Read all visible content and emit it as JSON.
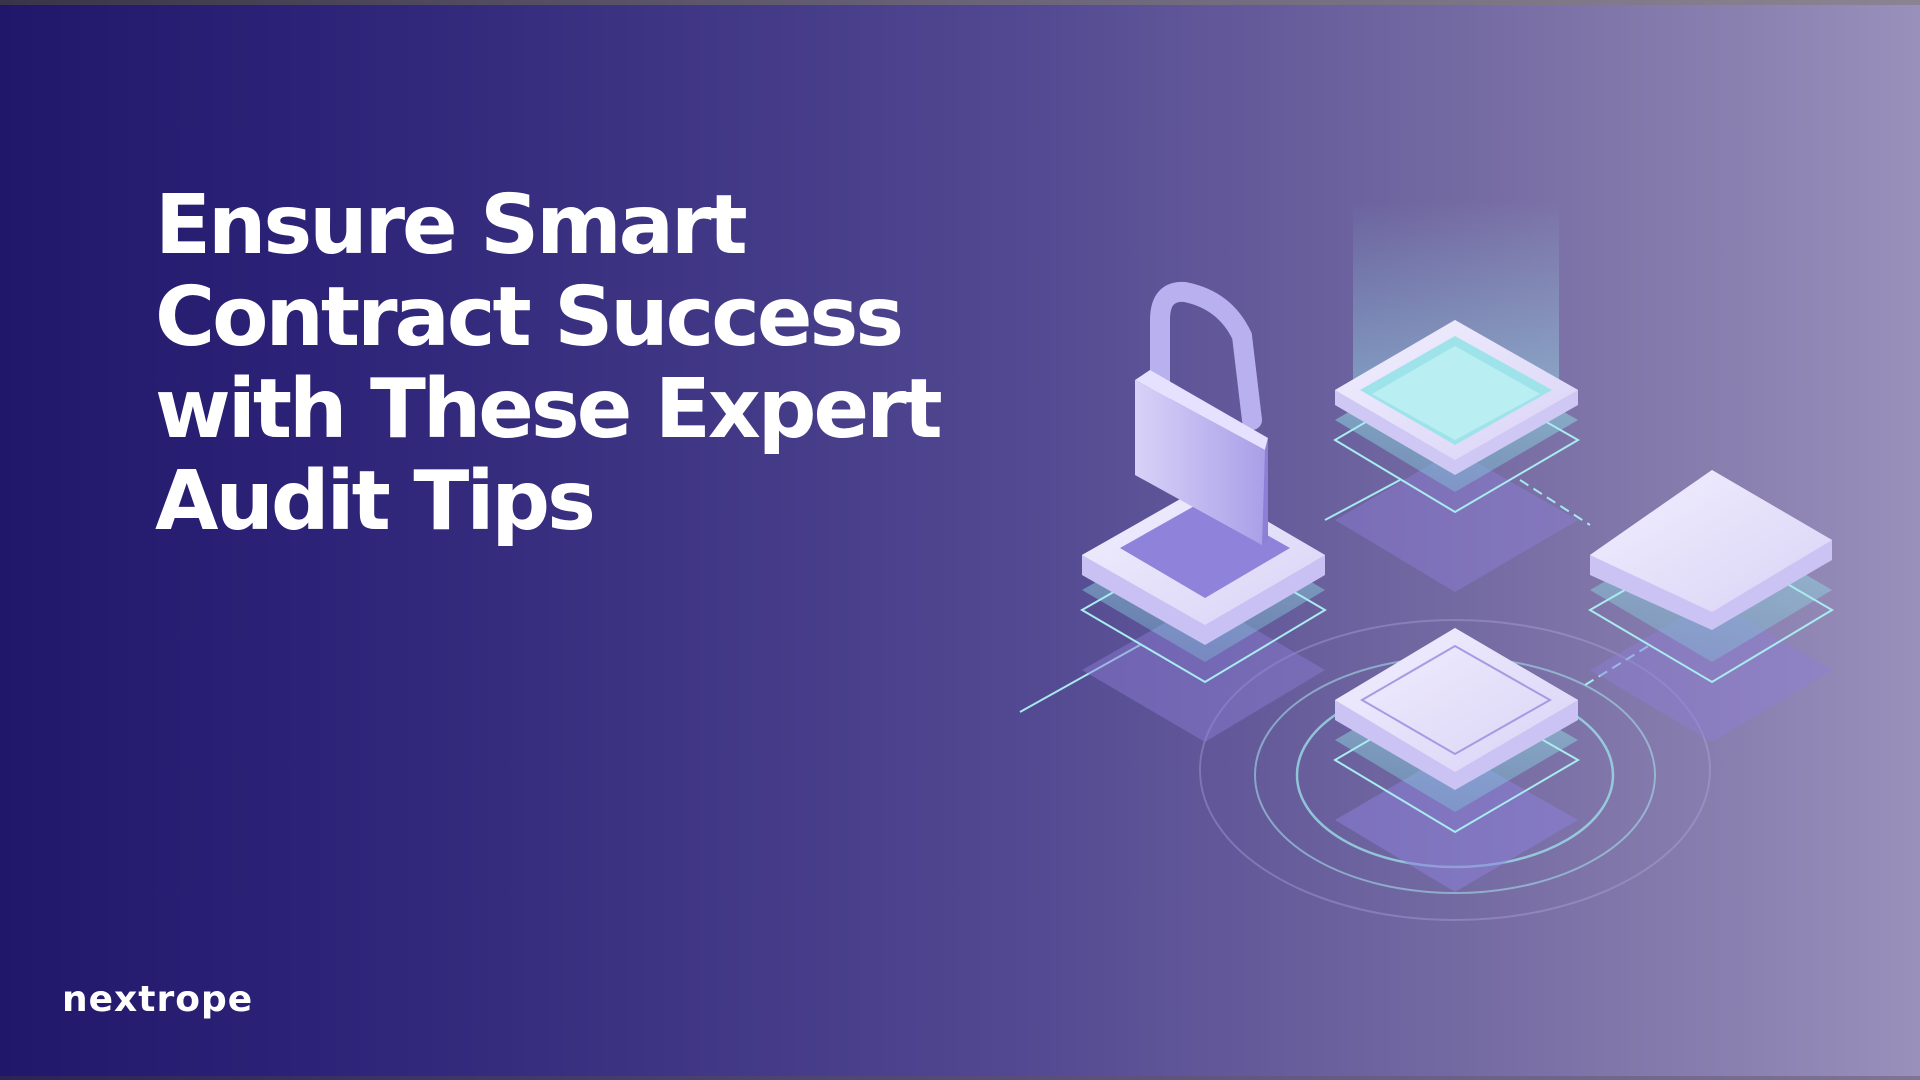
{
  "slide": {
    "headline_lines": [
      "Ensure Smart",
      "Contract Success",
      "with These Expert",
      "Audit Tips"
    ]
  },
  "brand": {
    "logo": "nextrope"
  },
  "illustration": {
    "icons": [
      "padlock-icon",
      "blockchain-block-icon"
    ]
  },
  "colors": {
    "background_left": "#21176a",
    "background_right": "#9a90bc",
    "text": "#ffffff",
    "accent_cyan": "#8fe3e8",
    "tile_lavender": "#ddd8f7"
  }
}
